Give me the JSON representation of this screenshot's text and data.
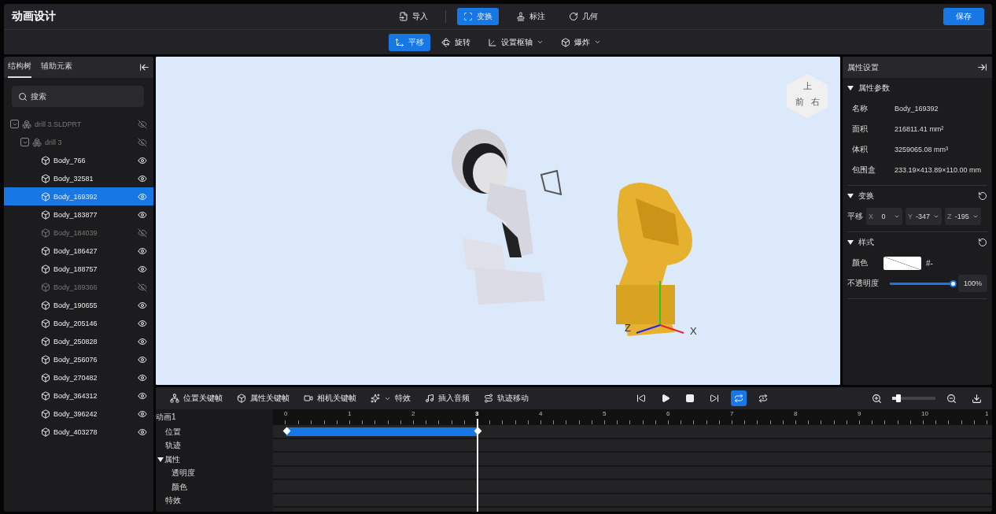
{
  "app": {
    "title": "动画设计",
    "save": "保存"
  },
  "main_tabs": [
    {
      "label": "导入",
      "selected": false
    },
    {
      "label": "变换",
      "selected": true
    },
    {
      "label": "标注",
      "selected": false
    },
    {
      "label": "几何",
      "selected": false
    }
  ],
  "sub_tools": [
    {
      "label": "平移",
      "selected": true,
      "dropdown": false
    },
    {
      "label": "旋转",
      "selected": false,
      "dropdown": false
    },
    {
      "label": "设置枢轴",
      "selected": false,
      "dropdown": true
    },
    {
      "label": "爆炸",
      "selected": false,
      "dropdown": true
    }
  ],
  "left_panel": {
    "tabs": [
      {
        "label": "结构树",
        "selected": true
      },
      {
        "label": "辅助元素",
        "selected": false
      }
    ],
    "search": {
      "placeholder": "搜索"
    },
    "tree": [
      {
        "kind": "assembly",
        "name": "drill 3.SLDPRT",
        "hidden": true,
        "selected": false,
        "expanded": true,
        "children": [
          {
            "kind": "assembly",
            "name": "drill 3",
            "hidden": true,
            "selected": false,
            "expanded": true,
            "children": [
              {
                "kind": "body",
                "name": "Body_766",
                "hidden": false,
                "selected": false
              },
              {
                "kind": "body",
                "name": "Body_32581",
                "hidden": false,
                "selected": false
              },
              {
                "kind": "body",
                "name": "Body_169392",
                "hidden": false,
                "selected": true
              },
              {
                "kind": "body",
                "name": "Body_183877",
                "hidden": false,
                "selected": false
              },
              {
                "kind": "body",
                "name": "Body_184039",
                "hidden": true,
                "selected": false
              },
              {
                "kind": "body",
                "name": "Body_186427",
                "hidden": false,
                "selected": false
              },
              {
                "kind": "body",
                "name": "Body_188757",
                "hidden": false,
                "selected": false
              },
              {
                "kind": "body",
                "name": "Body_189366",
                "hidden": true,
                "selected": false
              },
              {
                "kind": "body",
                "name": "Body_190655",
                "hidden": false,
                "selected": false
              },
              {
                "kind": "body",
                "name": "Body_205146",
                "hidden": false,
                "selected": false
              },
              {
                "kind": "body",
                "name": "Body_250828",
                "hidden": false,
                "selected": false
              },
              {
                "kind": "body",
                "name": "Body_256076",
                "hidden": false,
                "selected": false
              },
              {
                "kind": "body",
                "name": "Body_270482",
                "hidden": false,
                "selected": false
              },
              {
                "kind": "body",
                "name": "Body_364312",
                "hidden": false,
                "selected": false
              },
              {
                "kind": "body",
                "name": "Body_396242",
                "hidden": false,
                "selected": false
              },
              {
                "kind": "body",
                "name": "Body_403278",
                "hidden": false,
                "selected": false
              }
            ]
          }
        ]
      }
    ]
  },
  "viewport": {
    "kind": "picture",
    "view_cube": [
      "上",
      "前",
      "右"
    ],
    "axes": [
      "Z",
      "X"
    ]
  },
  "properties": {
    "title": "属性设置",
    "params": {
      "heading": "属性参数",
      "expanded": true,
      "rows": [
        {
          "label": "名称",
          "value": "Body_169392"
        },
        {
          "label": "面积",
          "value": "216811.41 mm²"
        },
        {
          "label": "体积",
          "value": "3259065.08 mm³"
        },
        {
          "label": "包围盒",
          "value": "233.19×413.89×110.00 mm"
        }
      ]
    },
    "transform": {
      "heading": "变换",
      "expanded": true,
      "label": "平移",
      "fields": [
        {
          "axis": "X",
          "value": "0"
        },
        {
          "axis": "Y",
          "value": "-347"
        },
        {
          "axis": "Z",
          "value": "-195"
        }
      ]
    },
    "style": {
      "heading": "样式",
      "expanded": true,
      "color_label": "颜色",
      "color_value": "#-",
      "opacity_label": "不透明度",
      "opacity": {
        "level": 1
      },
      "opacity_value": "100%"
    }
  },
  "timeline": {
    "tools": [
      {
        "label": "位置关键帧",
        "dropdown": false
      },
      {
        "label": "属性关键帧",
        "dropdown": false
      },
      {
        "label": "相机关键帧",
        "dropdown": false
      },
      {
        "label": "特效",
        "dropdown": true
      },
      {
        "label": "插入音频",
        "dropdown": false
      },
      {
        "label": "轨迹移动",
        "dropdown": false
      }
    ],
    "playback": [
      {
        "kind": "prev",
        "selected": false
      },
      {
        "kind": "play",
        "selected": false
      },
      {
        "kind": "stop",
        "selected": false
      },
      {
        "kind": "next",
        "selected": false
      },
      {
        "kind": "loop",
        "selected": true
      },
      {
        "kind": "loop-once",
        "selected": false
      }
    ],
    "zoom": {
      "level": 0.15
    },
    "animation": "动画1",
    "ticks": [
      {
        "label": "0",
        "playhead": false
      },
      {
        "label": "1",
        "playhead": false
      },
      {
        "label": "2",
        "playhead": false
      },
      {
        "label": "3",
        "playhead": true
      },
      {
        "label": "4",
        "playhead": false
      },
      {
        "label": "5",
        "playhead": false
      },
      {
        "label": "6",
        "playhead": false
      },
      {
        "label": "7",
        "playhead": false
      },
      {
        "label": "8",
        "playhead": false
      },
      {
        "label": "9",
        "playhead": false
      },
      {
        "label": "10",
        "playhead": false
      },
      {
        "label": "1",
        "playhead": false
      }
    ],
    "tracks": [
      {
        "label": "位置",
        "clip": true
      },
      {
        "label": "轨迹",
        "clip": false
      },
      {
        "label": "属性",
        "clip": false,
        "expanded": true,
        "children": [
          {
            "label": "透明度"
          },
          {
            "label": "颜色"
          }
        ]
      },
      {
        "label": "特效",
        "clip": false
      }
    ]
  }
}
